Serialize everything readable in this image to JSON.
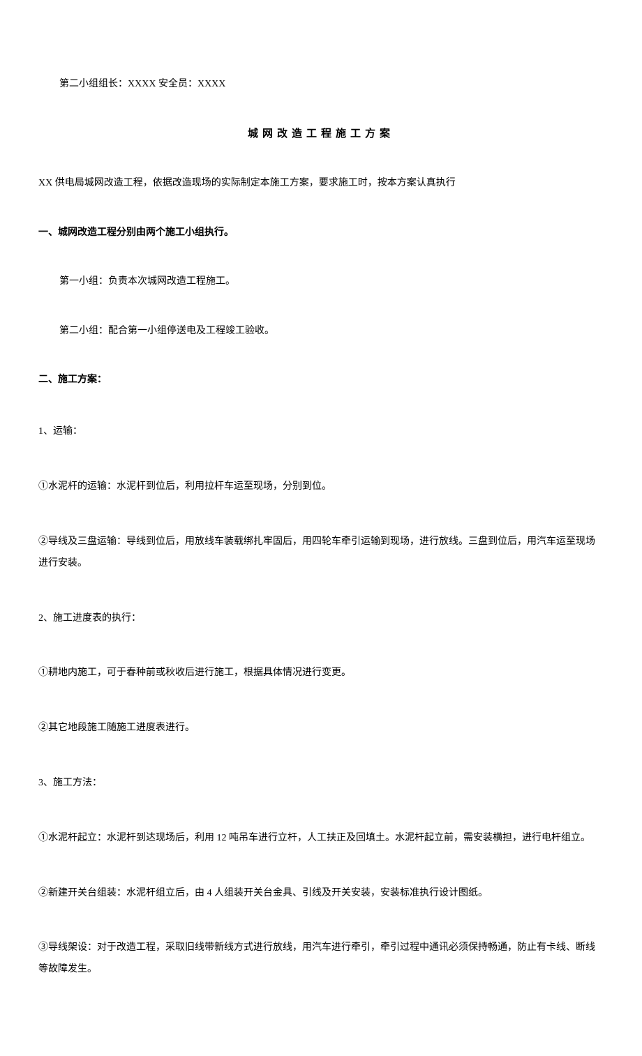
{
  "header": {
    "group_leader_label": "第二小组组长：",
    "group_leader_value": "XXXX",
    "safety_officer_label": " 安全员：",
    "safety_officer_value": "XXXX"
  },
  "title": "城网改造工程施工方案",
  "intro": "XX 供电局城网改造工程，依据改造现场的实际制定本施工方案，要求施工时，按本方案认真执行",
  "section1": {
    "heading": "一、城网改造工程分别由两个施工小组执行。",
    "item1": "第一小组：负责本次城网改造工程施工。",
    "item2": "第二小组：配合第一小组停送电及工程竣工验收。"
  },
  "section2": {
    "heading": "二、施工方案：",
    "sub1": {
      "heading": "1、运输：",
      "p1": "①水泥杆的运输：水泥杆到位后，利用拉杆车运至现场，分别到位。",
      "p2": "②导线及三盘运输：导线到位后，用放线车装载绑扎牢固后，用四轮车牵引运输到现场，进行放线。三盘到位后，用汽车运至现场进行安装。"
    },
    "sub2": {
      "heading": "2、施工进度表的执行：",
      "p1": "①耕地内施工，可于春种前或秋收后进行施工，根据具体情况进行变更。",
      "p2": "②其它地段施工随施工进度表进行。"
    },
    "sub3": {
      "heading": "3、施工方法：",
      "p1": "①水泥杆起立：水泥杆到达现场后，利用 12 吨吊车进行立杆，人工扶正及回填土。水泥杆起立前，需安装横担，进行电杆组立。",
      "p2": "②新建开关台组装：水泥杆组立后，由 4 人组装开关台金具、引线及开关安装，安装标准执行设计图纸。",
      "p3": "③导线架设：对于改造工程，采取旧线带新线方式进行放线，用汽车进行牵引，牵引过程中通讯必须保持畅通，防止有卡线、断线等故障发生。"
    }
  }
}
